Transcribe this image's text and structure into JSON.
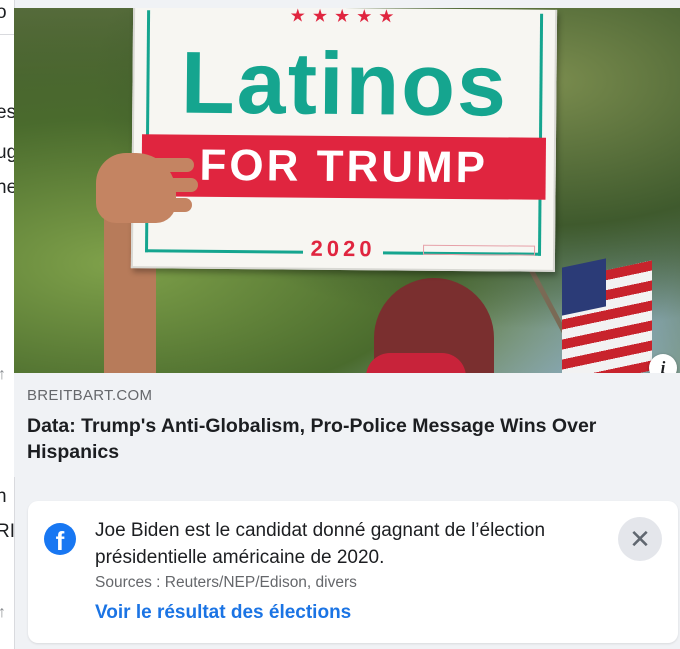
{
  "left_strip": {
    "fragments": [
      "o",
      "es",
      "ug",
      "he",
      "n",
      "RI"
    ],
    "arrow_glyph": "↑"
  },
  "link_preview": {
    "image": {
      "sign_stars": "★★★★★",
      "sign_line1": "Latinos",
      "sign_line2": "FOR TRUMP",
      "sign_year": "2020"
    },
    "info_icon_glyph": "i",
    "domain": "BREITBART.COM",
    "headline": "Data: Trump's Anti-Globalism, Pro-Police Message Wins Over Hispanics"
  },
  "election_notice": {
    "icon": "facebook-icon",
    "icon_glyph": "f",
    "text": "Joe Biden est le candidat donné gagnant de l’élection présidentielle américaine de 2020.",
    "sources": "Sources : Reuters/NEP/Edison, divers",
    "link_label": "Voir le résultat des élections",
    "close_glyph": "✕"
  },
  "colors": {
    "sign_teal": "#15a58f",
    "sign_red": "#e0253f",
    "facebook_blue": "#1877f2",
    "link_blue": "#1b74e4"
  }
}
